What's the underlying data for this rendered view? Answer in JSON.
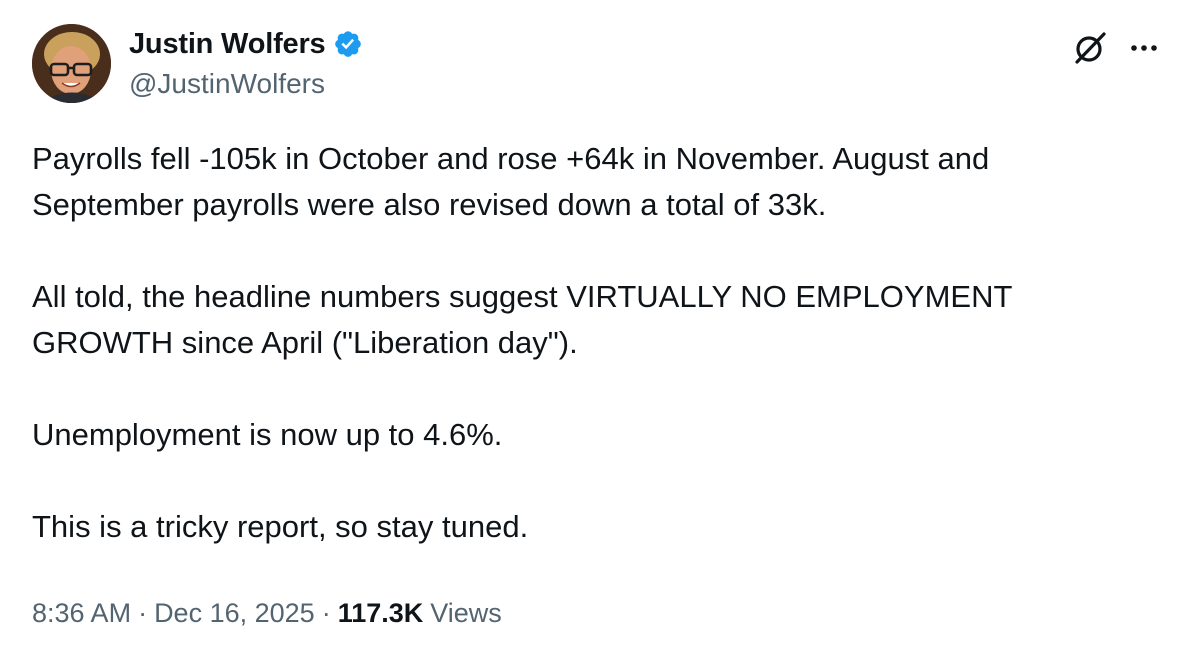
{
  "author": {
    "display_name": "Justin Wolfers",
    "handle": "@JustinWolfers",
    "verified": true,
    "verified_color": "#1d9bf0",
    "avatar_icon": "avatar-photo"
  },
  "header_actions": {
    "grok_icon": "grok-icon",
    "more_icon": "more-icon"
  },
  "tweet": {
    "paragraphs": [
      "Payrolls fell -105k in October and rose +64k in November. August and\nSeptember payrolls were also revised down a total of 33k.",
      "All told, the headline numbers suggest VIRTUALLY NO EMPLOYMENT\nGROWTH since April (\"Liberation day\").",
      "Unemployment is now up to 4.6%.",
      "This is a tricky report, so stay tuned."
    ]
  },
  "meta": {
    "time": "8:36 AM",
    "separator": "·",
    "date": "Dec 16, 2025",
    "views_count": "117.3K",
    "views_label": "Views"
  },
  "colors": {
    "text": "#0f1419",
    "secondary": "#536471",
    "background": "#ffffff"
  }
}
